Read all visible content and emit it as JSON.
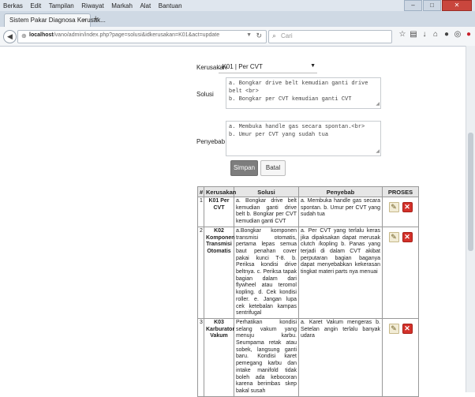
{
  "menubar": {
    "items": [
      "Berkas",
      "Edit",
      "Tampilan",
      "Riwayat",
      "Markah",
      "Alat",
      "Bantuan"
    ]
  },
  "window_controls": {
    "minimize": "–",
    "maximize": "□",
    "close": "✕"
  },
  "tab": {
    "title": "Sistem Pakar Diagnosa Kerusak...",
    "close": "×",
    "new_tab": "+"
  },
  "navbar": {
    "url_host": "localhost",
    "url_path": "/vano/admin/index.php?page=solusi&idkerusakan=K01&act=update",
    "search_placeholder": "Cari",
    "search_icon": "search-icon",
    "icons": [
      "star-icon",
      "bookmarks-icon",
      "download-icon",
      "home-icon",
      "pocket-icon",
      "extension-icon",
      "adblock-icon",
      "menu-icon"
    ]
  },
  "form": {
    "kerusakan_label": "Kerusakan",
    "kerusakan_value": ": K01 | Per CVT",
    "solusi_label": "Solusi",
    "solusi_lines": [
      "a. Bongkar drive belt kemudian ganti drive belt <br>",
      "b. Bongkar per CVT kemudian ganti CVT"
    ],
    "penyebab_label": "Penyebab",
    "penyebab_lines": [
      "a. Membuka handle gas secara spontan.<br>",
      "b. Umur per CVT yang sudah tua"
    ],
    "save_label": "Simpan",
    "cancel_label": "Batal"
  },
  "table": {
    "headers": [
      "#",
      "Kerusakan",
      "Solusi",
      "Penyebab",
      "PROSES"
    ],
    "rows": [
      {
        "no": "1",
        "kerusakan": "K01 Per CVT",
        "solusi": "a. Bongkar drive belt kemudian ganti drive belt b. Bongkar per CVT kemudian ganti CVT",
        "penyebab": "a. Membuka handle gas secara spontan. b. Umur per CVT yang sudah tua"
      },
      {
        "no": "2",
        "kerusakan": "K02 Komponen Transmisi Otomatis",
        "solusi": "a.Bongkar komponen transmisi otomatis, pertama lepas semua baut penahan cover pakai kunci T-8. b. Periksa kondisi drive beltnya. c. Periksa tapak bagian dalam dari flywheel atau teromol kopling. d. Cek kondisi roller. e. Jangan lupa cek ketebalan kampas sentrifugal",
        "penyebab": "a. Per CVT yang terlalu keras jika dipaksakan dapat merusak clutch /kopling b. Panas yang terjadi di dalam CVT akibat perputaran bagian baganya dapat menyebabkan kekerasan tingkat materi parts nya menuai"
      },
      {
        "no": "3",
        "kerusakan": "K03 Karburator Vakum",
        "solusi": "Perhatikan kondisi selang vakum yang menuju karbu. Seumpama retak atau sobek, langsung ganti baru. Kondisi karet pemegang karbu dan intake manifold tidak boleh ada kebocoran karena berimbas skep bakal susah",
        "penyebab": "a. Karet Vakum mengeras b. Setelan angin terlalu banyak udara"
      }
    ]
  }
}
